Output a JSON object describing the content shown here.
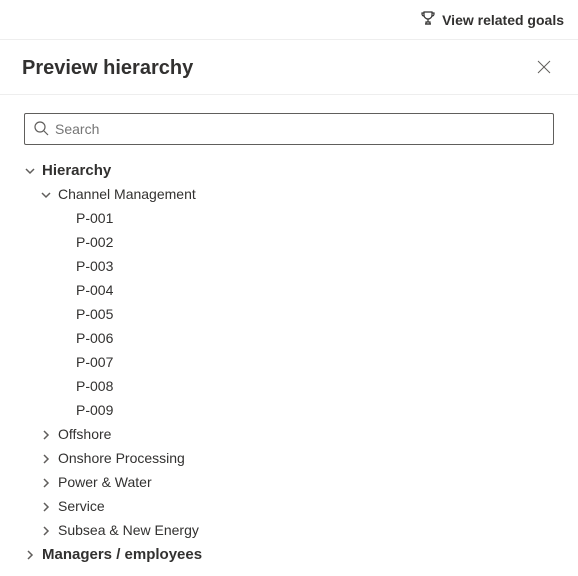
{
  "topbar": {
    "link_label": "View related goals"
  },
  "panel": {
    "title": "Preview hierarchy"
  },
  "search": {
    "placeholder": "Search",
    "value": ""
  },
  "tree": {
    "root": {
      "label": "Hierarchy",
      "expanded": true
    },
    "groups": [
      {
        "label": "Channel Management",
        "expanded": true,
        "items": [
          {
            "label": "P-001"
          },
          {
            "label": "P-002"
          },
          {
            "label": "P-003"
          },
          {
            "label": "P-004"
          },
          {
            "label": "P-005"
          },
          {
            "label": "P-006"
          },
          {
            "label": "P-007"
          },
          {
            "label": "P-008"
          },
          {
            "label": "P-009"
          }
        ]
      },
      {
        "label": "Offshore",
        "expanded": false
      },
      {
        "label": "Onshore Processing",
        "expanded": false
      },
      {
        "label": "Power & Water",
        "expanded": false
      },
      {
        "label": "Service",
        "expanded": false
      },
      {
        "label": "Subsea & New Energy",
        "expanded": false
      }
    ],
    "second_root": {
      "label": "Managers / employees",
      "expanded": false
    }
  }
}
